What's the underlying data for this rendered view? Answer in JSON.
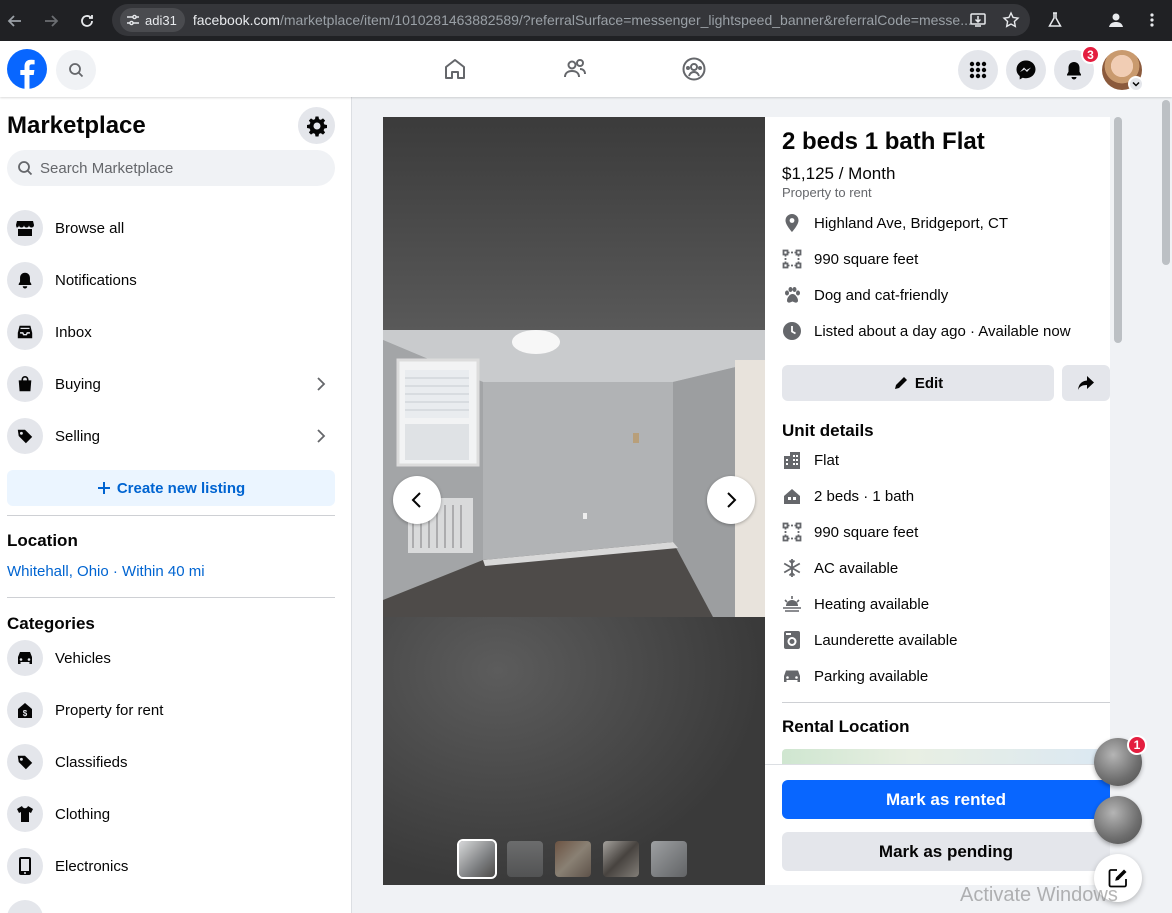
{
  "browser": {
    "site_chip": "adi31",
    "url_host": "facebook.com",
    "url_path": "/marketplace/item/1010281463882589/?referralSurface=messenger_lightspeed_banner&referralCode=messe..."
  },
  "header": {
    "notification_count": "3"
  },
  "sidebar": {
    "title": "Marketplace",
    "search_placeholder": "Search Marketplace",
    "nav": [
      {
        "label": "Browse all",
        "icon": "storefront-icon"
      },
      {
        "label": "Notifications",
        "icon": "bell-icon"
      },
      {
        "label": "Inbox",
        "icon": "inbox-icon"
      },
      {
        "label": "Buying",
        "icon": "shopping-bag-icon"
      },
      {
        "label": "Selling",
        "icon": "price-tag-icon"
      }
    ],
    "create_listing": "Create new listing",
    "location_heading": "Location",
    "location_value": "Whitehall, Ohio · Within 40 mi",
    "categories_heading": "Categories",
    "categories": [
      {
        "label": "Vehicles",
        "icon": "car-icon"
      },
      {
        "label": "Property for rent",
        "icon": "house-dollar-icon"
      },
      {
        "label": "Classifieds",
        "icon": "tag-icon"
      },
      {
        "label": "Clothing",
        "icon": "shirt-icon"
      },
      {
        "label": "Electronics",
        "icon": "phone-icon"
      }
    ]
  },
  "listing": {
    "title": "2 beds 1 bath Flat",
    "price": "$1,125 / Month",
    "category": "Property to rent",
    "facts": [
      {
        "text": "Highland Ave, Bridgeport, CT",
        "icon": "location-pin-icon"
      },
      {
        "text": "990 square feet",
        "icon": "area-icon"
      },
      {
        "text": "Dog and cat-friendly",
        "icon": "paw-icon"
      },
      {
        "text": "Listed about a day ago · Available now",
        "icon": "clock-icon"
      }
    ],
    "edit_label": "Edit",
    "unit_details_heading": "Unit details",
    "unit_details": [
      {
        "text": "Flat",
        "icon": "building-icon"
      },
      {
        "text": "2 beds · 1 bath",
        "icon": "house-icon"
      },
      {
        "text": "990 square feet",
        "icon": "area-icon"
      },
      {
        "text": "AC available",
        "icon": "snowflake-icon"
      },
      {
        "text": "Heating available",
        "icon": "sun-heat-icon"
      },
      {
        "text": "Launderette available",
        "icon": "washer-icon"
      },
      {
        "text": "Parking available",
        "icon": "car-icon"
      }
    ],
    "rental_location_heading": "Rental Location",
    "mark_rented": "Mark as rented",
    "mark_pending": "Mark as pending"
  },
  "chat": {
    "unread_count": "1"
  },
  "watermark": "Activate Windows"
}
